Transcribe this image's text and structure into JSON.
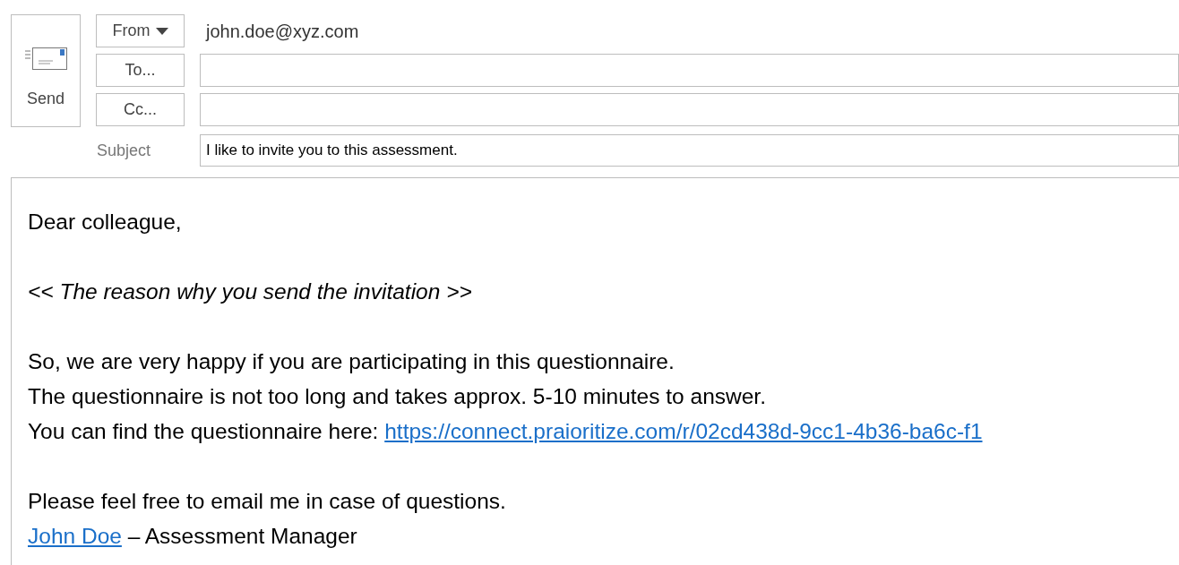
{
  "send_button": {
    "label": "Send"
  },
  "from": {
    "label": "From",
    "value": "john.doe@xyz.com"
  },
  "to": {
    "label": "To..."
  },
  "cc": {
    "label": "Cc..."
  },
  "subject": {
    "label": "Subject",
    "value": "I like to invite you to this assessment."
  },
  "body": {
    "paragraphs": [
      {
        "lines": [
          {
            "italic": false,
            "segments": [
              {
                "kind": "text",
                "text": "Dear colleague,"
              }
            ]
          }
        ]
      },
      {
        "lines": [
          {
            "italic": true,
            "segments": [
              {
                "kind": "text",
                "text": "<< The reason why you send the invitation >>"
              }
            ]
          }
        ]
      },
      {
        "lines": [
          {
            "italic": false,
            "segments": [
              {
                "kind": "text",
                "text": "So, we are very happy if you are participating in this questionnaire."
              }
            ]
          },
          {
            "italic": false,
            "segments": [
              {
                "kind": "text",
                "text": "The questionnaire is not too long and takes approx. 5-10 minutes to answer."
              }
            ]
          },
          {
            "italic": false,
            "segments": [
              {
                "kind": "text",
                "text": "You can find the questionnaire here: "
              },
              {
                "kind": "link",
                "text": "https://connect.praioritize.com/r/02cd438d-9cc1-4b36-ba6c-f1"
              }
            ]
          }
        ]
      },
      {
        "lines": [
          {
            "italic": false,
            "segments": [
              {
                "kind": "text",
                "text": "Please feel free to email me in case of questions."
              }
            ]
          },
          {
            "italic": false,
            "segments": [
              {
                "kind": "link",
                "text": "John Doe"
              },
              {
                "kind": "text",
                "text": " – Assessment Manager"
              }
            ]
          }
        ]
      }
    ]
  }
}
